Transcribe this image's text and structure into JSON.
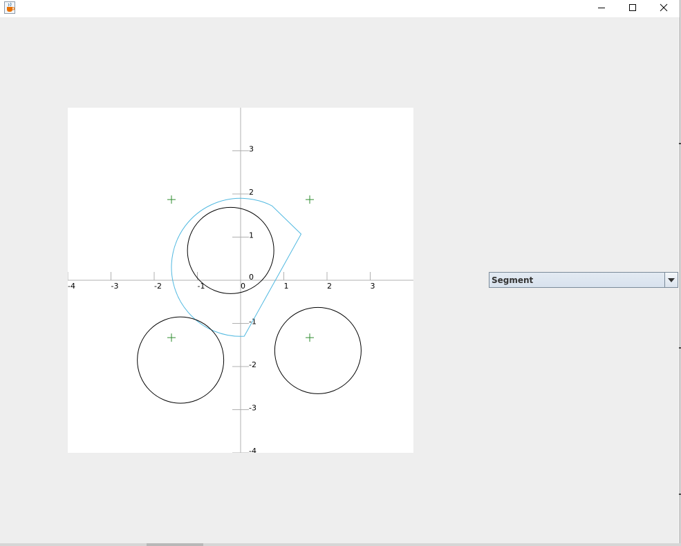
{
  "window": {
    "title_icon": "java-coffee-cup-icon",
    "controls": [
      "minimize-icon",
      "maximize-icon",
      "close-icon"
    ]
  },
  "chart_data": {
    "type": "scatter",
    "title": "",
    "xlabel": "",
    "ylabel": "",
    "xlim": [
      -4,
      4
    ],
    "ylim": [
      -4,
      4
    ],
    "grid": false,
    "x_ticks": [
      -4,
      -3,
      -2,
      -1,
      0,
      1,
      2,
      3
    ],
    "y_ticks": [
      3,
      2,
      1,
      0,
      -1,
      -2,
      -3,
      -4
    ],
    "x_tick_labels": [
      "-4",
      "-3",
      "-2",
      "-1",
      "0",
      "1",
      "2",
      "3"
    ],
    "y_tick_labels": [
      "3",
      "2",
      "1",
      "0",
      "-1",
      "-2",
      "-3",
      "-4"
    ],
    "markers": [
      {
        "x": -1.6,
        "y": 1.87
      },
      {
        "x": 1.6,
        "y": 1.87
      },
      {
        "x": -1.6,
        "y": -1.33
      },
      {
        "x": 1.6,
        "y": -1.33
      }
    ],
    "marker_color": "#2e8b2e",
    "circles": [
      {
        "cx": -0.23,
        "cy": 0.69,
        "r": 1.0
      },
      {
        "cx": -1.39,
        "cy": -1.85,
        "r": 1.0
      },
      {
        "cx": 1.79,
        "cy": -1.63,
        "r": 1.0
      }
    ],
    "circle_color": "#000000",
    "sector": {
      "cx": 0.0,
      "cy": 0.3,
      "r": 1.6,
      "color": "#4fb8e0"
    },
    "axis_color": "#b0b0b0"
  },
  "combo": {
    "value": "Segment",
    "arrow_icon": "dropdown-arrow-icon"
  }
}
